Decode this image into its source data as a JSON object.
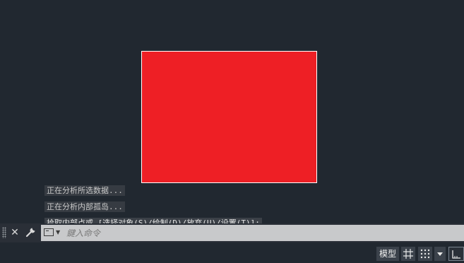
{
  "canvas": {
    "shape_color": "#EE1F25",
    "background_color": "#212830"
  },
  "command_history": [
    "正在分析所选数据...",
    "正在分析内部孤岛...",
    "拾取内部点或 [选择对象(S)/绘制(D)/放弃(U)/设置(T)]:"
  ],
  "command_line": {
    "placeholder": "鍵入命令",
    "close_icon": "close-icon",
    "customize_icon": "wrench-icon",
    "prompt_icon": "command-prompt-icon"
  },
  "status_bar": {
    "model_label": "模型",
    "grid_icon": "grid-icon",
    "snap_icon": "snap-mode-icon",
    "menu_icon": "chevron-down-icon",
    "ortho_icon": "ortho-mode-icon"
  }
}
